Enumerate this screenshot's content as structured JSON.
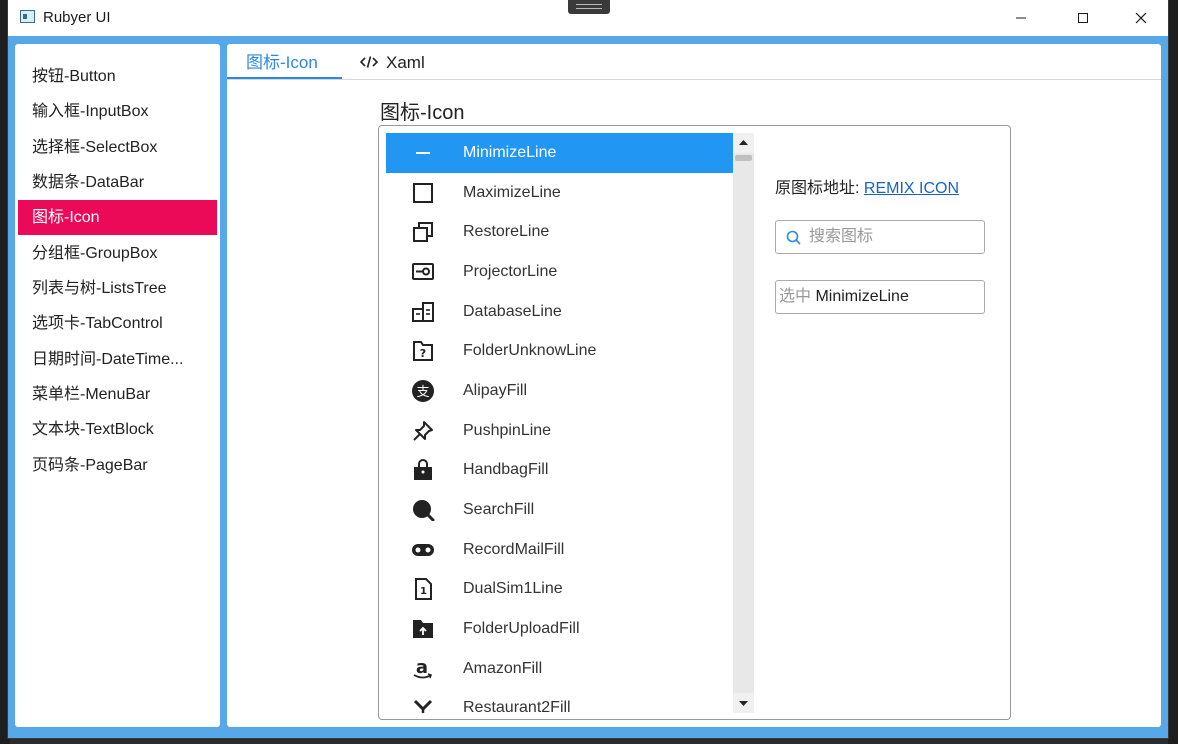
{
  "window": {
    "title": "Rubyer UI",
    "controls": [
      "minimize",
      "maximize",
      "close"
    ]
  },
  "sidebar": {
    "items": [
      {
        "label": "按钮-Button"
      },
      {
        "label": "输入框-InputBox"
      },
      {
        "label": "选择框-SelectBox"
      },
      {
        "label": "数据条-DataBar"
      },
      {
        "label": "图标-Icon",
        "active": true
      },
      {
        "label": "分组框-GroupBox"
      },
      {
        "label": "列表与树-ListsTree"
      },
      {
        "label": "选项卡-TabControl"
      },
      {
        "label": "日期时间-DateTime..."
      },
      {
        "label": "菜单栏-MenuBar"
      },
      {
        "label": "文本块-TextBlock"
      },
      {
        "label": "页码条-PageBar"
      }
    ],
    "active_color": "#ea0a58"
  },
  "tabs": [
    {
      "label": "图标-Icon",
      "active": true
    },
    {
      "label": "Xaml",
      "icon": "code-icon"
    }
  ],
  "content": {
    "section_title": "图标-Icon",
    "icons": [
      {
        "name": "MinimizeLine",
        "icon": "minimize-line-icon",
        "selected": true
      },
      {
        "name": "MaximizeLine",
        "icon": "maximize-line-icon"
      },
      {
        "name": "RestoreLine",
        "icon": "restore-line-icon"
      },
      {
        "name": "ProjectorLine",
        "icon": "projector-line-icon"
      },
      {
        "name": "DatabaseLine",
        "icon": "database-line-icon"
      },
      {
        "name": "FolderUnknowLine",
        "icon": "folder-unknow-line-icon"
      },
      {
        "name": "AlipayFill",
        "icon": "alipay-fill-icon"
      },
      {
        "name": "PushpinLine",
        "icon": "pushpin-line-icon"
      },
      {
        "name": "HandbagFill",
        "icon": "handbag-fill-icon"
      },
      {
        "name": "SearchFill",
        "icon": "search-fill-icon"
      },
      {
        "name": "RecordMailFill",
        "icon": "record-mail-fill-icon"
      },
      {
        "name": "DualSim1Line",
        "icon": "dual-sim-1-line-icon"
      },
      {
        "name": "FolderUploadFill",
        "icon": "folder-upload-fill-icon"
      },
      {
        "name": "AmazonFill",
        "icon": "amazon-fill-icon"
      },
      {
        "name": "Restaurant2Fill",
        "icon": "restaurant-2-fill-icon"
      }
    ],
    "source_label": "原图标地址:",
    "source_link": "REMIX ICON",
    "search_placeholder": "搜索图标",
    "search_value": "",
    "selected_prefix": "选中",
    "selected_value": "MinimizeLine"
  },
  "colors": {
    "accent": "#2a8ae0",
    "selection": "#2196f3",
    "window_frame": "#56a8e8"
  }
}
